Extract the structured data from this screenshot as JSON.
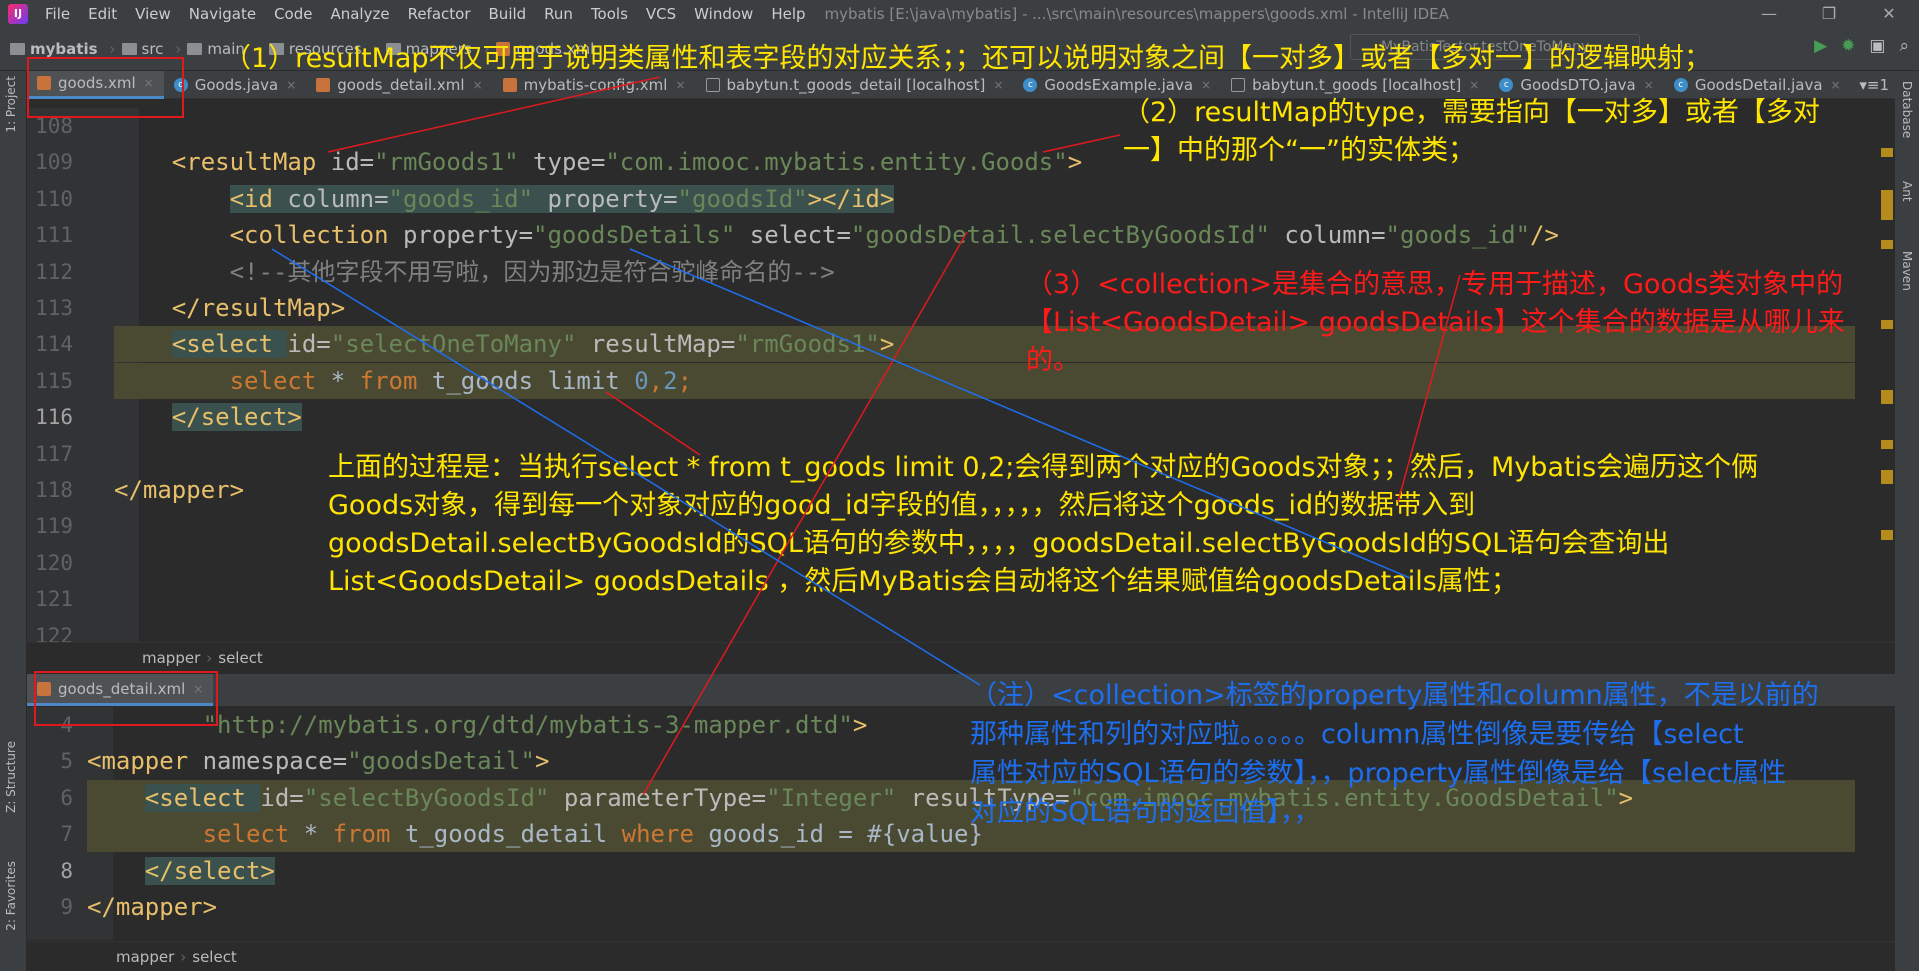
{
  "window": {
    "title": "mybatis [E:\\java\\mybatis] - ...\\src\\main\\resources\\mappers\\goods.xml - IntelliJ IDEA",
    "menu": [
      "File",
      "Edit",
      "View",
      "Navigate",
      "Code",
      "Analyze",
      "Refactor",
      "Build",
      "Run",
      "Tools",
      "VCS",
      "Window",
      "Help"
    ],
    "controls": [
      "—",
      "❐",
      "✕"
    ]
  },
  "breadcrumb": [
    "mybatis",
    "src",
    "main",
    "resources",
    "mappers",
    "goods.xml"
  ],
  "run_config": "MyBatisTestor.testOneToMany",
  "tabs": [
    {
      "label": "goods.xml",
      "type": "xml",
      "active": true
    },
    {
      "label": "Goods.java",
      "type": "java"
    },
    {
      "label": "goods_detail.xml",
      "type": "xml"
    },
    {
      "label": "mybatis-config.xml",
      "type": "xml"
    },
    {
      "label": "babytun.t_goods_detail [localhost]",
      "type": "table"
    },
    {
      "label": "GoodsExample.java",
      "type": "java"
    },
    {
      "label": "babytun.t_goods [localhost]",
      "type": "table"
    },
    {
      "label": "GoodsDTO.java",
      "type": "java"
    },
    {
      "label": "GoodsDetail.java",
      "type": "java"
    }
  ],
  "tabs_overflow": "▾≡1",
  "side_tools": {
    "project": "1: Project",
    "structure": "Z: Structure",
    "favorites": "2: Favorites",
    "database": "Database",
    "ant": "Ant",
    "maven": "Maven"
  },
  "top_editor": {
    "lines": [
      {
        "n": 108,
        "t": []
      },
      {
        "n": 109,
        "t": [
          [
            "    ",
            ""
          ],
          [
            "<resultMap ",
            "tag"
          ],
          [
            "id=",
            "attr"
          ],
          [
            "\"rmGoods1\"",
            "val"
          ],
          [
            " type=",
            "attr"
          ],
          [
            "\"com.imooc.mybatis.entity.Goods\"",
            "val"
          ],
          [
            ">",
            "tag"
          ]
        ]
      },
      {
        "n": 110,
        "t": [
          [
            "        ",
            ""
          ],
          [
            "<id ",
            "tag tagbg"
          ],
          [
            "column=",
            "attr tagbg"
          ],
          [
            "\"goods_id\"",
            "val tagbg"
          ],
          [
            " property=",
            "attr tagbg"
          ],
          [
            "\"goodsId\"",
            "val tagbg"
          ],
          [
            "></id>",
            "tag tagbg"
          ]
        ]
      },
      {
        "n": 111,
        "t": [
          [
            "        ",
            ""
          ],
          [
            "<collection ",
            "tag"
          ],
          [
            "property=",
            "attr"
          ],
          [
            "\"goodsDetails\"",
            "val"
          ],
          [
            " select=",
            "attr"
          ],
          [
            "\"goodsDetail.selectByGoodsId\"",
            "val"
          ],
          [
            " column=",
            "attr"
          ],
          [
            "\"goods_id\"",
            "val"
          ],
          [
            "/>",
            "tag"
          ]
        ]
      },
      {
        "n": 112,
        "t": [
          [
            "        ",
            ""
          ],
          [
            "<!--其他字段不用写啦，因为那边是符合驼峰命名的-->",
            "cmt"
          ]
        ]
      },
      {
        "n": 113,
        "t": [
          [
            "    ",
            ""
          ],
          [
            "</resultMap>",
            "tag"
          ]
        ]
      },
      {
        "n": 114,
        "t": [
          [
            "    ",
            ""
          ],
          [
            "<select ",
            "tag tagbg"
          ],
          [
            "id=",
            "attr"
          ],
          [
            "\"selectOneToMany\"",
            "val"
          ],
          [
            " resultMap=",
            "attr"
          ],
          [
            "\"rmGoods1\"",
            "val"
          ],
          [
            ">",
            "tag"
          ]
        ],
        "hl": true
      },
      {
        "n": 115,
        "t": [
          [
            "        ",
            ""
          ],
          [
            "select ",
            "kw"
          ],
          [
            "* ",
            "txt"
          ],
          [
            "from ",
            "kw"
          ],
          [
            "t_goods limit ",
            "txt"
          ],
          [
            "0",
            "num"
          ],
          [
            ",",
            "kw"
          ],
          [
            "2",
            "num"
          ],
          [
            ";",
            "kw"
          ]
        ],
        "hl": true
      },
      {
        "n": 116,
        "t": [
          [
            "    ",
            ""
          ],
          [
            "</select>",
            "tag tagbg"
          ]
        ],
        "cur": true
      },
      {
        "n": 117,
        "t": []
      },
      {
        "n": 118,
        "t": [
          [
            "</mapper>",
            "tag"
          ]
        ]
      },
      {
        "n": 119,
        "t": []
      },
      {
        "n": 120,
        "t": []
      },
      {
        "n": 121,
        "t": []
      },
      {
        "n": 122,
        "t": []
      }
    ],
    "breadcrumb": [
      "mapper",
      "select"
    ]
  },
  "bottom_editor": {
    "tab": "goods_detail.xml",
    "lines": [
      {
        "n": 4,
        "t": [
          [
            "        ",
            ""
          ],
          [
            "\"http://mybatis.org/dtd/mybatis-3-mapper.dtd\"",
            "val"
          ],
          [
            ">",
            "tag"
          ]
        ]
      },
      {
        "n": 5,
        "t": [
          [
            "<mapper ",
            "tag"
          ],
          [
            "namespace=",
            "attr"
          ],
          [
            "\"goodsDetail\"",
            "val"
          ],
          [
            ">",
            "tag"
          ]
        ]
      },
      {
        "n": 6,
        "t": [
          [
            "    ",
            ""
          ],
          [
            "<select ",
            "tag tagbg"
          ],
          [
            "id=",
            "attr"
          ],
          [
            "\"selectByGoodsId\"",
            "val"
          ],
          [
            " parameterType=",
            "attr"
          ],
          [
            "\"Integer\"",
            "val"
          ],
          [
            " resultType=",
            "attr"
          ],
          [
            "\"com.imooc.mybatis.entity.GoodsDetail\"",
            "val"
          ],
          [
            ">",
            "tag"
          ]
        ],
        "hl": true
      },
      {
        "n": 7,
        "t": [
          [
            "        ",
            ""
          ],
          [
            "select ",
            "kw"
          ],
          [
            "* ",
            "txt"
          ],
          [
            "from ",
            "kw"
          ],
          [
            "t_goods_detail ",
            "txt"
          ],
          [
            "where ",
            "kw"
          ],
          [
            "goods_id = #{value}",
            "txt"
          ]
        ],
        "hl": true
      },
      {
        "n": 8,
        "t": [
          [
            "    ",
            ""
          ],
          [
            "</select>",
            "tag tagbg"
          ]
        ],
        "cur": true
      },
      {
        "n": 9,
        "t": [
          [
            "</mapper>",
            "tag"
          ]
        ]
      }
    ],
    "breadcrumb": [
      "mapper",
      "select"
    ]
  },
  "annotations": {
    "note1": "（1）resultMap不仅可用于说明类属性和表字段的对应关系；；还可以说明对象之间【一对多】或者【多对一】的逻辑映射；",
    "note2": [
      "（2）resultMap的type，需要指向【一对多】或者【多对",
      "一】中的那个“一”的实体类；"
    ],
    "note3": [
      "（3）<collection>是集合的意思，专用于描述，Goods类对象中的",
      "【List<GoodsDetail> goodsDetails】这个集合的数据是从哪儿来",
      "的。"
    ],
    "note4": [
      "上面的过程是：当执行select * from t_goods limit 0,2;会得到两个对应的Goods对象；；然后，Mybatis会遍历这个俩",
      "Goods对象，得到每一个对象对应的good_id字段的值，，，，，然后将这个goods_id的数据带入到",
      "goodsDetail.selectByGoodsId的SQL语句的参数中，，，，goodsDetail.selectByGoodsId的SQL语句会查询出",
      "List<GoodsDetail> goodsDetails ，然后MyBatis会自动将这个结果赋值给goodsDetails属性；"
    ],
    "note5": [
      "（注）<collection>标签的property属性和column属性，不是以前的",
      "那种属性和列的对应啦。。。。。column属性倒像是要传给【select",
      "属性对应的SQL语句的参数】，，property属性倒像是给【select属性",
      "对应的SQL语句的返回值】，，"
    ]
  },
  "colors": {
    "yellow": "#ffe500",
    "red": "#ff1a1a",
    "blue": "#1d6ff0",
    "bg": "#2b2b2b"
  }
}
